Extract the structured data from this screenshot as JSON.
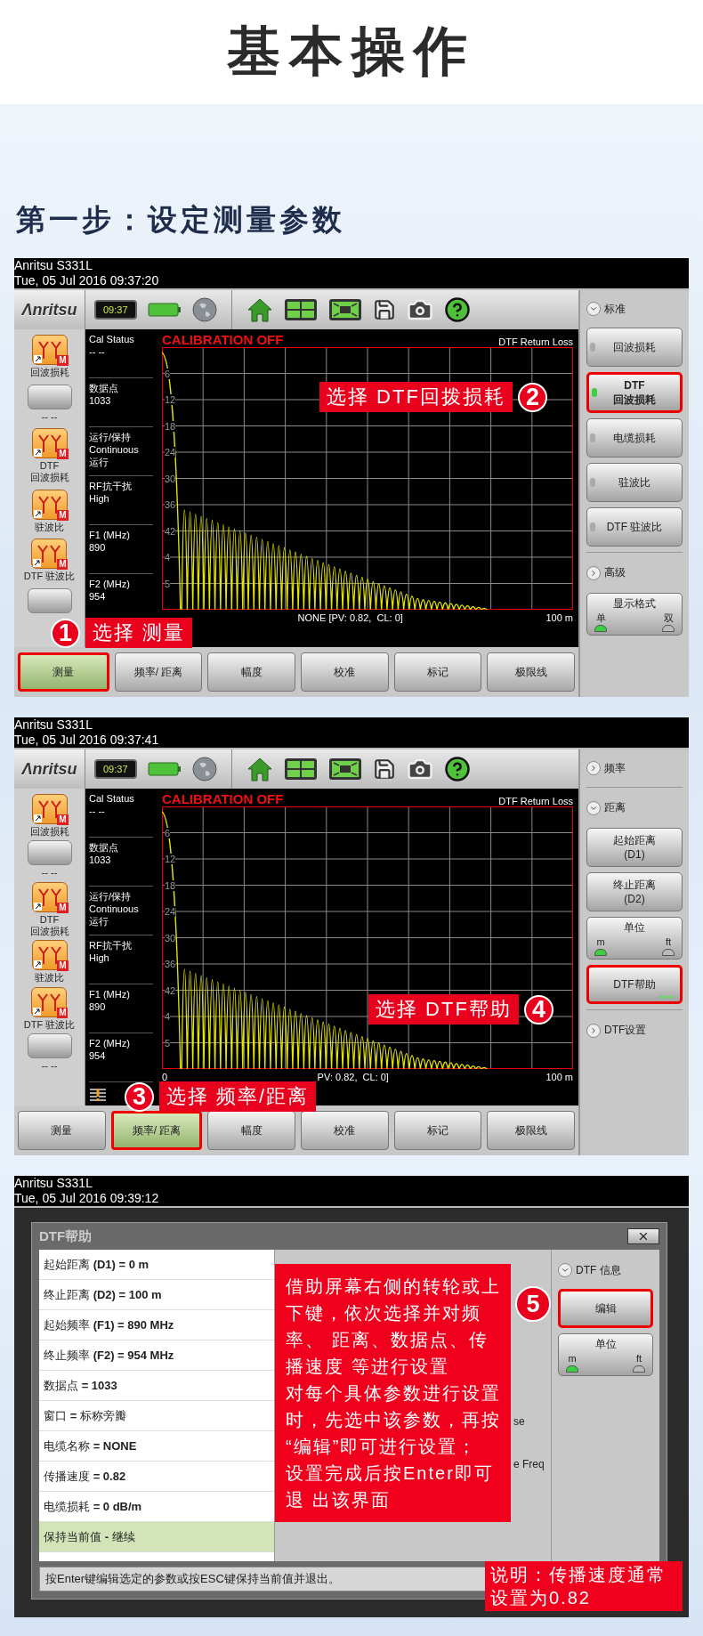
{
  "page_title": "基本操作",
  "step_title": "第一步：设定测量参数",
  "screens": [
    {
      "kind": "analyzer",
      "title_bar": {
        "model": "Anritsu S331L",
        "datetime": "Tue, 05 Jul 2016 09:37:20"
      },
      "logo": "Λnritsu",
      "clock": "09:37",
      "left_icons": [
        {
          "kind": "antenna",
          "badge": "M",
          "lines": [
            "回波损耗"
          ]
        },
        {
          "kind": "blank",
          "lines": [
            "-- --"
          ]
        },
        {
          "kind": "antenna",
          "badge": "M",
          "lines": [
            "DTF",
            "回波损耗"
          ]
        },
        {
          "kind": "antenna",
          "badge": "M",
          "lines": [
            "驻波比"
          ]
        },
        {
          "kind": "antenna",
          "badge": "M",
          "lines": [
            "DTF 驻波比"
          ]
        },
        {
          "kind": "blank"
        }
      ],
      "info": [
        {
          "label": "Cal Status",
          "values": [
            "-- --"
          ]
        },
        {
          "label": "数据点",
          "values": [
            "1033"
          ]
        },
        {
          "label": "运行/保持",
          "values": [
            "Continuous",
            "运行"
          ]
        },
        {
          "label": "RF抗干扰",
          "values": [
            "High"
          ]
        },
        {
          "label": "F1 (MHz)",
          "values": [
            "890"
          ]
        },
        {
          "label": "F2 (MHz)",
          "values": [
            "954"
          ]
        }
      ],
      "chart": {
        "status": "CALIBRATION OFF",
        "trace_name": "DTF Return Loss",
        "y_labels": [
          "6",
          "12",
          "18",
          "24",
          "30",
          "36",
          "42",
          "4",
          "5"
        ],
        "footer": "NONE [PV: 0.82,  CL: 0]",
        "end_label": "100 m"
      },
      "tabs": [
        {
          "label": "测量",
          "selected": true,
          "highlighted": true
        },
        {
          "label": "频率/ 距离",
          "selected": false,
          "highlighted": false
        },
        {
          "label": "幅度",
          "selected": false,
          "highlighted": false
        },
        {
          "label": "校准",
          "selected": false,
          "highlighted": false
        },
        {
          "label": "标记",
          "selected": false,
          "highlighted": false
        },
        {
          "label": "极限线",
          "selected": false,
          "highlighted": false
        }
      ],
      "right_panel": [
        {
          "kind": "group",
          "label": "标准",
          "expanded": true
        },
        {
          "kind": "option",
          "lines": [
            "回波损耗"
          ],
          "active": false,
          "highlighted": false
        },
        {
          "kind": "option",
          "lines": [
            "DTF",
            "回波损耗"
          ],
          "active": true,
          "highlighted": true
        },
        {
          "kind": "option",
          "lines": [
            "电缆损耗"
          ],
          "active": false,
          "highlighted": false
        },
        {
          "kind": "option",
          "lines": [
            "驻波比"
          ],
          "active": false,
          "highlighted": false
        },
        {
          "kind": "option",
          "lines": [
            "DTF 驻波比"
          ],
          "active": false,
          "highlighted": false
        },
        {
          "kind": "group",
          "label": "高级",
          "expanded": false
        },
        {
          "kind": "toggle",
          "label": "显示格式",
          "options": [
            {
              "label": "单",
              "selected": true
            },
            {
              "label": "双",
              "selected": false
            }
          ]
        }
      ],
      "callouts": [
        {
          "number": "1",
          "text": "选择 测量"
        },
        {
          "number": "2",
          "text": "选择 DTF回拨损耗"
        }
      ]
    },
    {
      "kind": "analyzer",
      "title_bar": {
        "model": "Anritsu S331L",
        "datetime": "Tue, 05 Jul 2016 09:37:41"
      },
      "logo": "Λnritsu",
      "clock": "09:37",
      "left_icons": [
        {
          "kind": "antenna",
          "badge": "M",
          "lines": [
            "回波损耗"
          ]
        },
        {
          "kind": "blank",
          "lines": [
            "-- --"
          ]
        },
        {
          "kind": "antenna",
          "badge": "M",
          "lines": [
            "DTF",
            "回波损耗"
          ]
        },
        {
          "kind": "antenna",
          "badge": "M",
          "lines": [
            "驻波比"
          ]
        },
        {
          "kind": "antenna",
          "badge": "M",
          "lines": [
            "DTF 驻波比"
          ]
        },
        {
          "kind": "blank",
          "lines": [
            "-- --"
          ]
        }
      ],
      "info": [
        {
          "label": "Cal Status",
          "values": [
            "-- --"
          ]
        },
        {
          "label": "数据点",
          "values": [
            "1033"
          ]
        },
        {
          "label": "运行/保持",
          "values": [
            "Continuous",
            "运行"
          ]
        },
        {
          "label": "RF抗干扰",
          "values": [
            "High"
          ]
        },
        {
          "label": "F1 (MHz)",
          "values": [
            "890"
          ]
        },
        {
          "label": "F2 (MHz)",
          "values": [
            "954"
          ]
        }
      ],
      "warning": true,
      "chart": {
        "status": "CALIBRATION OFF",
        "trace_name": "DTF Return Loss",
        "y_labels": [
          "6",
          "12",
          "18",
          "24",
          "30",
          "36",
          "42",
          "4",
          "5"
        ],
        "start_label": "0",
        "footer": "PV: 0.82,  CL: 0]",
        "end_label": "100 m"
      },
      "tabs": [
        {
          "label": "测量",
          "selected": false,
          "highlighted": false
        },
        {
          "label": "频率/ 距离",
          "selected": true,
          "highlighted": true
        },
        {
          "label": "幅度",
          "selected": false,
          "highlighted": false
        },
        {
          "label": "校准",
          "selected": false,
          "highlighted": false
        },
        {
          "label": "标记",
          "selected": false,
          "highlighted": false
        },
        {
          "label": "极限线",
          "selected": false,
          "highlighted": false
        }
      ],
      "right_panel": [
        {
          "kind": "group",
          "label": "频率",
          "expanded": false
        },
        {
          "kind": "group",
          "label": "距离",
          "expanded": true
        },
        {
          "kind": "button",
          "lines": [
            "起始距离",
            "(D1)"
          ],
          "highlighted": false
        },
        {
          "kind": "button",
          "lines": [
            "终止距离",
            "(D2)"
          ],
          "highlighted": false
        },
        {
          "kind": "toggle",
          "label": "单位",
          "options": [
            {
              "label": "m",
              "selected": true
            },
            {
              "label": "ft",
              "selected": false
            }
          ]
        },
        {
          "kind": "button",
          "lines": [
            "DTF帮助"
          ],
          "highlighted": true,
          "more": true
        },
        {
          "kind": "group",
          "label": "DTF设置",
          "expanded": false
        }
      ],
      "callouts": [
        {
          "number": "3",
          "text": "选择 频率/距离"
        },
        {
          "number": "4",
          "text": "选择 DTF帮助"
        }
      ]
    },
    {
      "kind": "dialog",
      "title_bar": {
        "model": "Anritsu S331L",
        "datetime": "Tue, 05 Jul 2016 09:39:12"
      },
      "dialog": {
        "title": "DTF帮助",
        "params": [
          {
            "text": "起始距离 **(D1) = 0 m**",
            "selected": false
          },
          {
            "text": "终止距离 **(D2) = 100 m**",
            "selected": false
          },
          {
            "text": "起始频率 **(F1) = 890 MHz**",
            "selected": false
          },
          {
            "text": "终止频率 **(F2) = 954 MHz**",
            "selected": false
          },
          {
            "text": "数据点 **= 1033**",
            "selected": false
          },
          {
            "text": "窗口 **=** 标称旁瓣",
            "selected": false
          },
          {
            "text": "电缆名称 **= NONE**",
            "selected": false
          },
          {
            "text": "传播速度 **= 0.82**",
            "selected": false
          },
          {
            "text": "电缆损耗 **= 0 dB/m**",
            "selected": false
          },
          {
            "text": "保持当前值 **-** 继续",
            "selected": true
          }
        ],
        "fragments": [
          "se",
          "e Freq"
        ],
        "right_panel": [
          {
            "kind": "group",
            "label": "DTF 信息",
            "expanded": true
          },
          {
            "kind": "button",
            "lines": [
              "编辑"
            ],
            "highlighted": true
          },
          {
            "kind": "toggle",
            "label": "单位",
            "options": [
              {
                "label": "m",
                "selected": true
              },
              {
                "label": "ft",
                "selected": false
              }
            ]
          }
        ],
        "status": "按Enter键编辑选定的参数或按ESC键保持当前值并退出。"
      },
      "callouts": [
        {
          "number": "5",
          "paragraphs": [
            "借助屏幕右侧的转轮或上下键，依次选择并对频率、 距离、数据点、传播速度 等进行设置",
            "对每个具体参数进行设置时，先选中该参数，再按 “编辑”即可进行设置；",
            "设置完成后按Enter即可退 出该界面"
          ]
        }
      ],
      "note": "说明：传播速度通常设置为0.82"
    }
  ]
}
